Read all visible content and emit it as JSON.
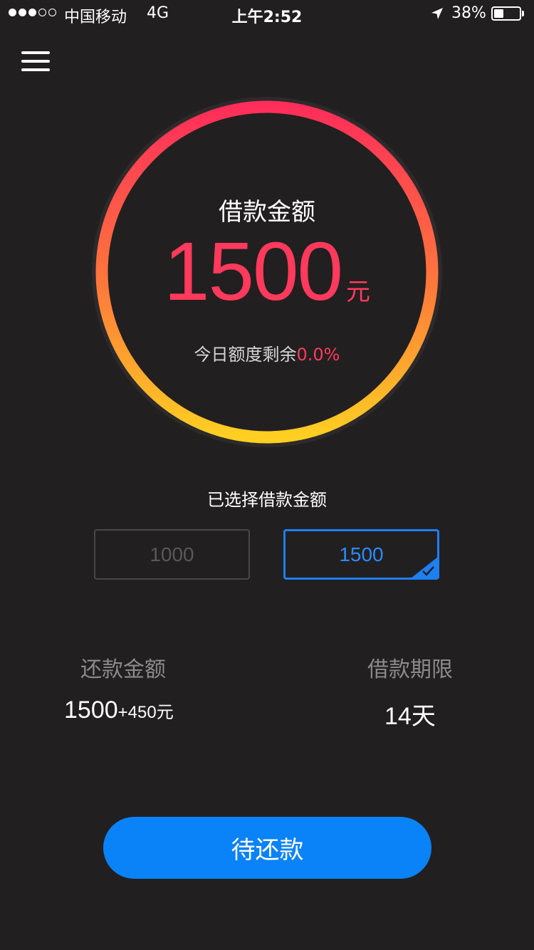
{
  "status_bar": {
    "carrier": "中国移动",
    "network": "4G",
    "time": "上午2:52",
    "battery_percent": "38%",
    "battery_level": 0.38,
    "signal_bars_filled": 3,
    "signal_bars_total": 5
  },
  "header": {
    "menu_icon": "hamburger-menu-icon"
  },
  "ring": {
    "title": "借款金额",
    "amount": "1500",
    "unit": "元",
    "remaining_label": "今日额度剩余",
    "remaining_value": "0.0%",
    "gradient_top": "#ff2d5a",
    "gradient_bottom": "#ffd022"
  },
  "selection": {
    "label": "已选择借款金额",
    "options": [
      {
        "value": "1000",
        "selected": false
      },
      {
        "value": "1500",
        "selected": true
      }
    ],
    "accent_color": "#1d7ff2"
  },
  "repayment": {
    "amount_label": "还款金额",
    "amount_value": "1500",
    "amount_extra": "+450元",
    "term_label": "借款期限",
    "term_value": "14天"
  },
  "action": {
    "button_label": "待还款",
    "button_color": "#0a82f8"
  }
}
